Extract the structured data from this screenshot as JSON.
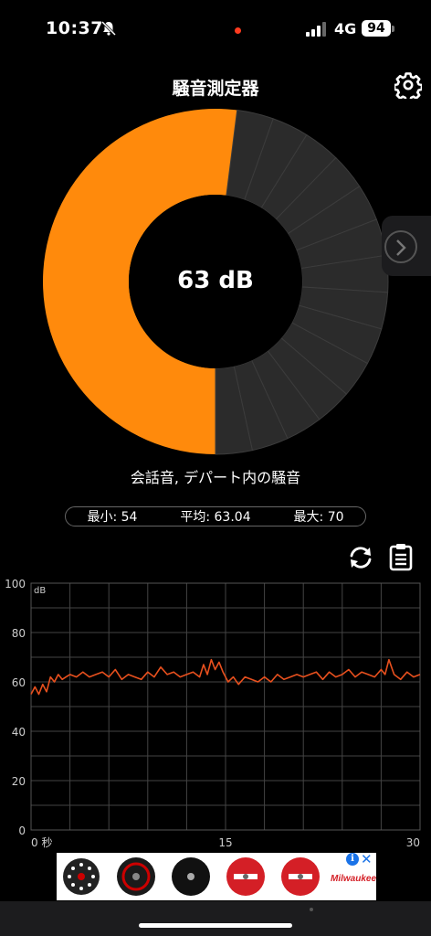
{
  "status_bar": {
    "time": "10:37",
    "network": "4G",
    "battery": "94",
    "icons": [
      "bell-slash-icon",
      "recording-dot-icon",
      "signal-bars-icon",
      "battery-icon"
    ]
  },
  "header": {
    "title": "騒音測定器",
    "settings_icon": "gear-icon"
  },
  "gauge": {
    "reading": "63 dB",
    "level_fraction": 0.52,
    "total_segments": 30,
    "active_color": "#ff8a0c",
    "inactive_color": "#2b2b2b"
  },
  "description": "会話音, デパート内の騒音",
  "stats": {
    "min": "最小: 54",
    "avg": "平均: 63.04",
    "max": "最大: 70"
  },
  "actions": {
    "refresh_icon": "refresh-icon",
    "clipboard_icon": "clipboard-icon",
    "next_icon": "chevron-right-icon"
  },
  "chart_data": {
    "type": "line",
    "ylabel": "dB",
    "ylim": [
      0,
      100
    ],
    "xlim": [
      0,
      30
    ],
    "y_ticks": [
      "0",
      "20",
      "40",
      "60",
      "80",
      "100"
    ],
    "x_ticks": [
      "0 秒",
      "15",
      "30"
    ],
    "grid": true,
    "series": [
      {
        "color": "#e8501e",
        "x": [
          0,
          0.3,
          0.6,
          0.9,
          1.2,
          1.5,
          1.8,
          2.1,
          2.4,
          2.7,
          3,
          3.5,
          4,
          4.5,
          5,
          5.5,
          6,
          6.5,
          7,
          7.5,
          8,
          8.5,
          9,
          9.5,
          10,
          10.5,
          11,
          11.5,
          12,
          12.5,
          13,
          13.3,
          13.6,
          13.9,
          14.2,
          14.5,
          14.8,
          15.2,
          15.6,
          16,
          16.5,
          17,
          17.5,
          18,
          18.5,
          19,
          19.5,
          20,
          20.5,
          21,
          21.5,
          22,
          22.5,
          23,
          23.5,
          24,
          24.5,
          25,
          25.5,
          26,
          26.5,
          27,
          27.3,
          27.6,
          28,
          28.5,
          29,
          29.5,
          30
        ],
        "y": [
          55,
          58,
          55,
          59,
          56,
          62,
          60,
          63,
          61,
          62,
          63,
          62,
          64,
          62,
          63,
          64,
          62,
          65,
          61,
          63,
          62,
          61,
          64,
          62,
          66,
          63,
          64,
          62,
          63,
          64,
          62,
          67,
          63,
          69,
          65,
          68,
          64,
          60,
          62,
          59,
          62,
          61,
          60,
          62,
          60,
          63,
          61,
          62,
          63,
          62,
          63,
          64,
          61,
          64,
          62,
          63,
          65,
          62,
          64,
          63,
          62,
          65,
          63,
          69,
          63,
          61,
          64,
          62,
          63
        ]
      }
    ]
  },
  "ad": {
    "brand": "Milwaukee",
    "info_icon": "info-icon",
    "close_icon": "close-icon",
    "thumbs": [
      "perforated-disc-image",
      "diamond-blade-image",
      "black-disc-image",
      "red-blade-image",
      "red-blade-image",
      "milwaukee-logo-image"
    ]
  }
}
